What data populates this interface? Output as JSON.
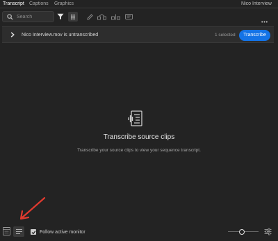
{
  "tabs": [
    {
      "label": "Transcript",
      "active": true
    },
    {
      "label": "Captions",
      "active": false
    },
    {
      "label": "Graphics",
      "active": false
    }
  ],
  "panel_title": "Nico Interview",
  "toolbar": {
    "search_placeholder": "Search",
    "icons": [
      "filter-icon",
      "align-icon",
      "edit-icon",
      "merge-icon",
      "split-icon",
      "captions-icon",
      "more-icon"
    ]
  },
  "banner": {
    "clip_status": "Nico Interview.mov is untranscribed",
    "selected_count": "1 selected",
    "transcribe_label": "Transcribe"
  },
  "empty_state": {
    "icon": "transcript-icon",
    "title": "Transcribe source clips",
    "subtitle": "Transcribe your source clips to view your sequence transcript."
  },
  "annotation": {
    "color": "#e03a2f"
  },
  "footer": {
    "follow_label": "Follow active monitor",
    "follow_checked": true,
    "zoom_level": 0.45
  },
  "colors": {
    "accent": "#1473e6",
    "background": "#232323",
    "annotation": "#e03a2f"
  }
}
